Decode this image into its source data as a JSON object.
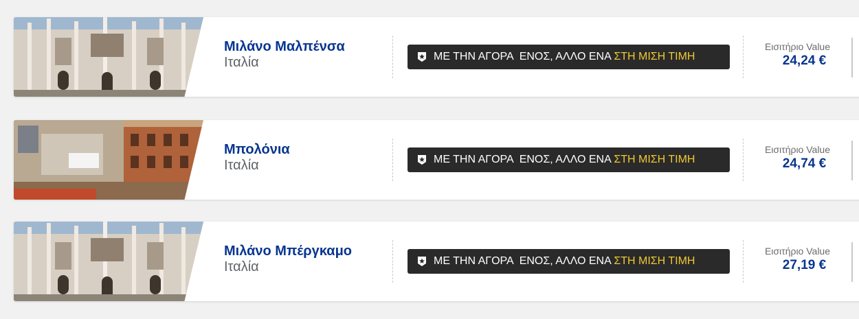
{
  "flights": [
    {
      "destination": "Μιλάνο Μαλπένσα",
      "country": "Ιταλία",
      "image": "milan-duomo",
      "promo_prefix": "ΜΕ ΤΗΝ ΑΓΟΡΑ  ΕΝΟΣ, ΑΛΛΟ ΕΝΑ ",
      "promo_highlight": "ΣΤΗ ΜΙΣΗ ΤΙΜΗ",
      "fare_label": "Εισιτήριο Value",
      "price": "24,24 €"
    },
    {
      "destination": "Μπολόνια",
      "country": "Ιταλία",
      "image": "bologna-piazza",
      "promo_prefix": "ΜΕ ΤΗΝ ΑΓΟΡΑ  ΕΝΟΣ, ΑΛΛΟ ΕΝΑ ",
      "promo_highlight": "ΣΤΗ ΜΙΣΗ ΤΙΜΗ",
      "fare_label": "Εισιτήριο Value",
      "price": "24,74 €"
    },
    {
      "destination": "Μιλάνο Μπέργκαμο",
      "country": "Ιταλία",
      "image": "milan-duomo",
      "promo_prefix": "ΜΕ ΤΗΝ ΑΓΟΡΑ  ΕΝΟΣ, ΑΛΛΟ ΕΝΑ ",
      "promo_highlight": "ΣΤΗ ΜΙΣΗ ΤΙΜΗ",
      "fare_label": "Εισιτήριο Value",
      "price": "27,19 €"
    }
  ],
  "colors": {
    "brand_blue": "#073590",
    "promo_bg": "#2a2a2a",
    "promo_highlight": "#f1c933",
    "page_bg": "#f1f1f1"
  },
  "icons": {
    "promo": "badge-star-icon"
  }
}
